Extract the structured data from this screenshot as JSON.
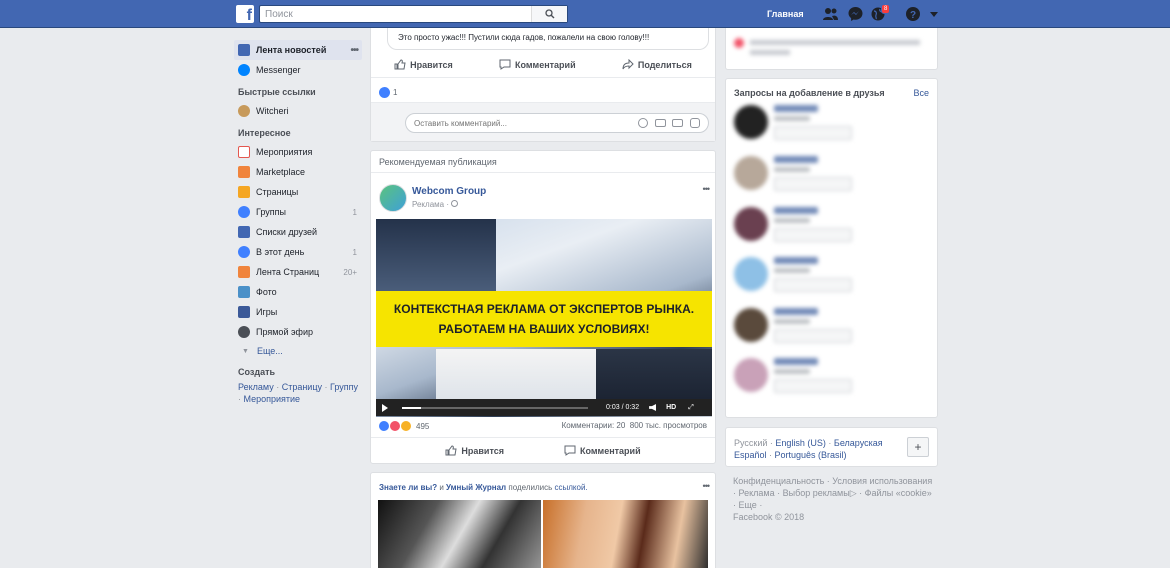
{
  "topbar": {
    "search_placeholder": "Поиск",
    "home_label": "Главная",
    "notif_count": "8"
  },
  "left_nav": {
    "main": [
      {
        "label": "Лента новостей",
        "icon": "news-feed-icon",
        "active": true
      },
      {
        "label": "Messenger",
        "icon": "messenger-icon"
      }
    ],
    "shortcuts_header": "Быстрые ссылки",
    "shortcuts": [
      {
        "label": "Witcheri",
        "icon": "witcheri-icon"
      }
    ],
    "explore_header": "Интересное",
    "explore": [
      {
        "label": "Мероприятия",
        "icon": "events-icon",
        "count": ""
      },
      {
        "label": "Marketplace",
        "icon": "marketplace-icon",
        "count": ""
      },
      {
        "label": "Страницы",
        "icon": "pages-icon",
        "count": ""
      },
      {
        "label": "Группы",
        "icon": "groups-icon",
        "count": "1"
      },
      {
        "label": "Списки друзей",
        "icon": "friend-lists-icon",
        "count": ""
      },
      {
        "label": "В этот день",
        "icon": "on-this-day-icon",
        "count": "1"
      },
      {
        "label": "Лента Страниц",
        "icon": "pages-feed-icon",
        "count": "20+"
      },
      {
        "label": "Фото",
        "icon": "photos-icon",
        "count": ""
      },
      {
        "label": "Игры",
        "icon": "games-icon",
        "count": ""
      },
      {
        "label": "Прямой эфир",
        "icon": "live-video-icon",
        "count": ""
      }
    ],
    "more_label": "Еще...",
    "create_header": "Создать",
    "create_links": [
      "Рекламу",
      "Страницу",
      "Группу",
      "Мероприятие"
    ]
  },
  "post1": {
    "comment_text": "Это просто ужас!!! Пустили сюда гадов, пожалели на свою голову!!!",
    "like_label": "Нравится",
    "comment_label": "Комментарий",
    "share_label": "Поделиться",
    "reactions_count": "1",
    "comment_placeholder": "Оставить комментарий..."
  },
  "ad_post": {
    "header": "Рекомендуемая публикация",
    "page_name": "Webcom Group",
    "sponsored": "Реклама",
    "banner_line1": "КОНТЕКСТНАЯ РЕКЛАМА ОТ ЭКСПЕРТОВ РЫНКА.",
    "banner_line2": "РАБОТАЕМ НА ВАШИХ УСЛОВИЯХ!",
    "video_time": "0:03 / 0:32",
    "video_quality": "HD",
    "video_progress": 0.1,
    "reactions_count": "495",
    "comments_stat": "Комментарии: 20",
    "views_stat": "800 тыс. просмотров",
    "like_label": "Нравится",
    "comment_label": "Комментарий"
  },
  "post3": {
    "author1": "Знаете ли вы?",
    "joiner": " и ",
    "author2": "Умный Журнал",
    "action": " поделились ",
    "link_word": "ссылкой."
  },
  "right": {
    "requests_title": "Запросы на добавление в друзья",
    "see_all": "Все",
    "languages": [
      "Русский",
      "English (US)",
      "Беларуская",
      "Español",
      "Português (Brasil)"
    ],
    "footer_links": [
      "Конфиденциальность",
      "Условия использования",
      "Реклама",
      "Выбор рекламы",
      "Файлы «cookie»",
      "Еще"
    ],
    "copyright": "Facebook © 2018"
  },
  "colors": {
    "brand": "#4267b2",
    "link": "#365899",
    "bg": "#e9ebee",
    "banner": "#f6e400"
  }
}
